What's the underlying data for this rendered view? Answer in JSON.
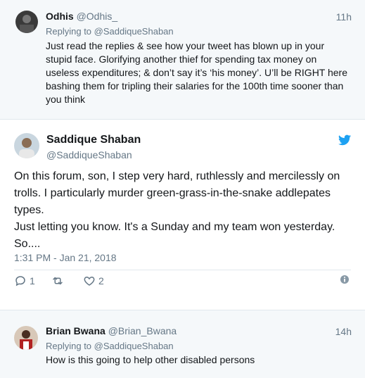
{
  "reply_top": {
    "name": "Odhis",
    "handle": "@Odhis_",
    "time": "11h",
    "replying_prefix": "Replying to",
    "replying_to": "@SaddiqueShaban",
    "text_lines": [
      "Just read the replies & see how your tweet has blown up in your",
      "stupid face. Glorifying another thief for spending tax money on",
      "useless expenditures; & don’t say it’s ‘his money’. U’ll be RIGHT here",
      "bashing them for tripling their salaries for the 100th time sooner than",
      "you think"
    ]
  },
  "main_tweet": {
    "name": "Saddique Shaban",
    "handle": "@SaddiqueShaban",
    "text_lines": [
      "On this forum, son, I step very hard, ruthlessly and mercilessly on",
      "trolls. I particularly murder green-grass-in-the-snake addlepates",
      "types.",
      "Just letting you know. It's a Sunday and my team won yesterday.",
      "So...."
    ],
    "timestamp": "1:31 PM - Jan 21, 2018",
    "reply_count": "1",
    "retweet_count": "",
    "like_count": "2"
  },
  "reply_bottom": {
    "name": "Brian Bwana",
    "handle": "@Brian_Bwana",
    "time": "14h",
    "replying_prefix": "Replying to",
    "replying_to": "@SaddiqueShaban",
    "text": "How is this going to help other disabled persons"
  },
  "colors": {
    "twitter_blue": "#1da1f2",
    "secondary_text": "#657786",
    "reply_bg": "#f5f8fa"
  },
  "icons": [
    "twitter-bird-icon",
    "reply-icon",
    "retweet-icon",
    "like-icon",
    "info-icon"
  ]
}
